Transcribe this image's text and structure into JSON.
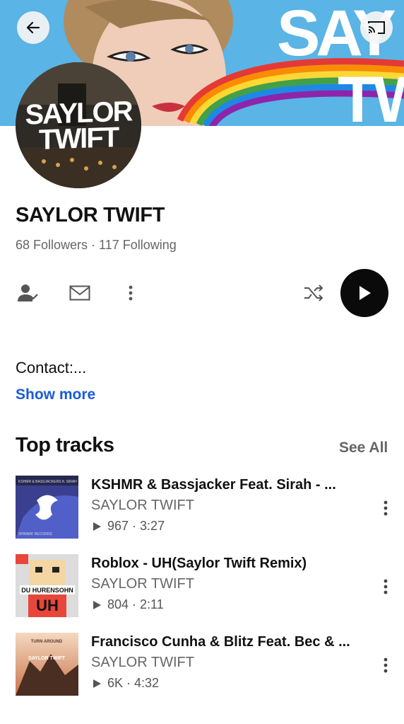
{
  "banner": {
    "title_fragment_1": "SAY",
    "title_fragment_2": "TW"
  },
  "avatar": {
    "line1": "SAYLOR",
    "line2": "TWIFT"
  },
  "profile": {
    "name": "SAYLOR TWIFT",
    "followers": "68 Followers · 117 Following"
  },
  "actions": {
    "follow_icon": "person-check-icon",
    "message_icon": "mail-icon",
    "more_icon": "more-vertical-icon",
    "shuffle_icon": "shuffle-icon",
    "play_icon": "play-icon"
  },
  "about": {
    "contact": "Contact:...",
    "show_more": "Show more"
  },
  "top_tracks": {
    "title": "Top tracks",
    "see_all": "See All",
    "items": [
      {
        "title": "KSHMR & Bassjacker  Feat. Sirah - ...",
        "artist": "SAYLOR TWIFT",
        "plays": "967",
        "duration": "3:27",
        "thumb_label": "KSHMR & BASSJACKERS ft. SIRAH",
        "thumb_sub": "SPINNIN' RECORDS"
      },
      {
        "title": "Roblox - UH(Saylor Twift Remix)",
        "artist": "SAYLOR TWIFT",
        "plays": "804",
        "duration": "2:11",
        "thumb_label": "DU HURENSOHN",
        "thumb_sub": "UH"
      },
      {
        "title": "Francisco Cunha & Blitz Feat. Bec & ...",
        "artist": "SAYLOR TWIFT",
        "plays": "6K",
        "duration": "4:32",
        "thumb_label": "TURN AROUND",
        "thumb_sub": "SAYLOR TWIFT"
      }
    ]
  }
}
